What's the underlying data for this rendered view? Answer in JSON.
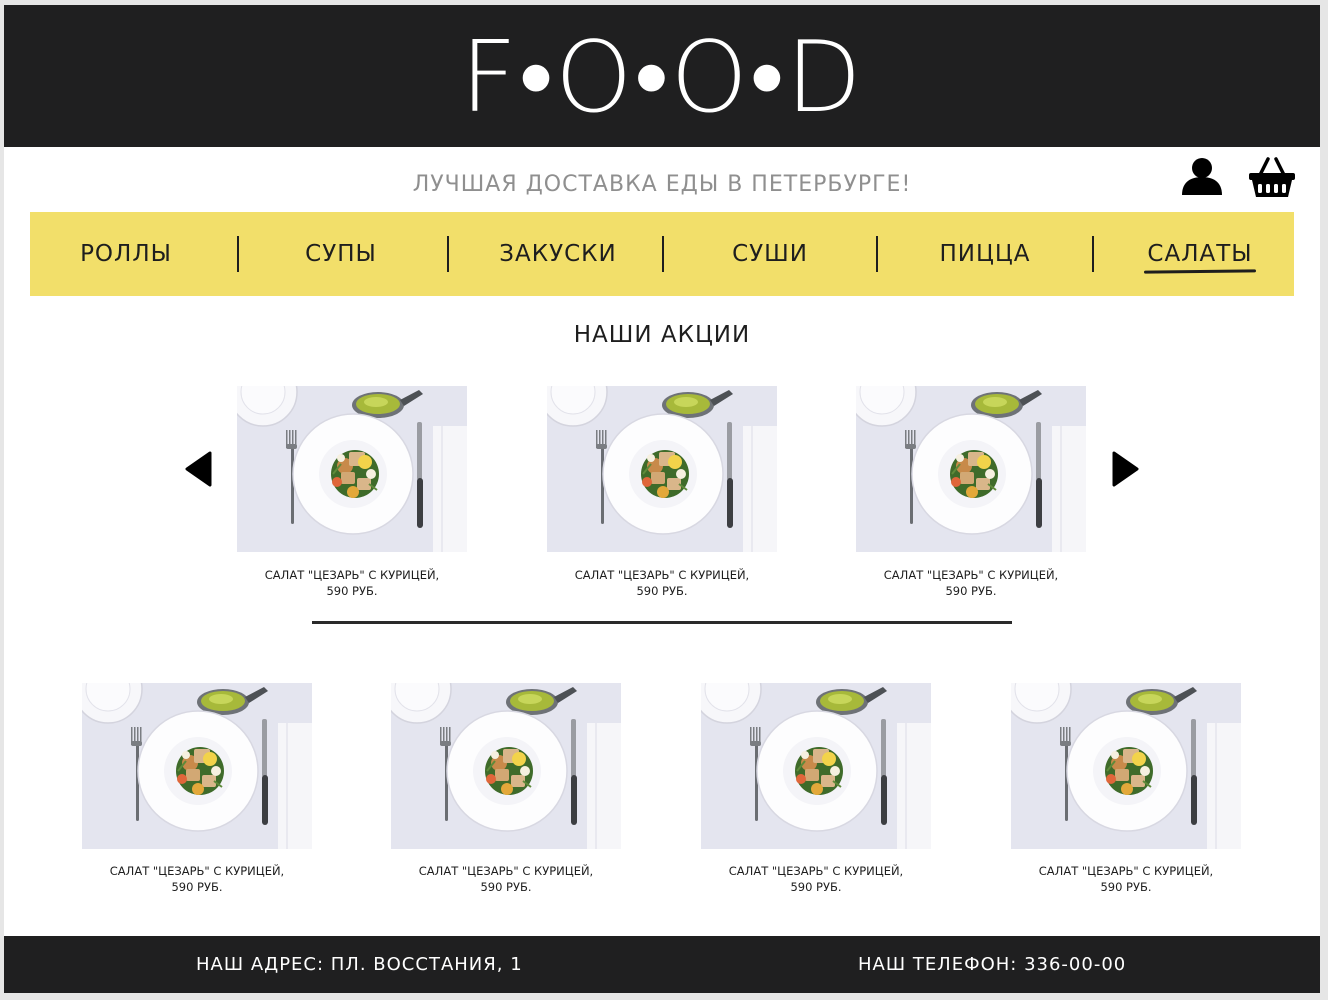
{
  "header": {
    "logo": "F•O•O•D"
  },
  "tagline": "ЛУЧШАЯ ДОСТАВКА ЕДЫ В ПЕТЕРБУРГЕ!",
  "icons": {
    "user": "user-icon",
    "cart": "basket-icon"
  },
  "nav": {
    "items": [
      "РОЛЛЫ",
      "СУПЫ",
      "ЗАКУСКИ",
      "СУШИ",
      "ПИЦЦА",
      "САЛАТЫ"
    ],
    "active": "САЛАТЫ"
  },
  "promo": {
    "title": "НАШИ АКЦИИ",
    "cards": [
      {
        "line1": "САЛАТ \"ЦЕЗАРЬ\" С КУРИЦЕЙ,",
        "line2": "590 РУБ."
      },
      {
        "line1": "САЛАТ \"ЦЕЗАРЬ\" С КУРИЦЕЙ,",
        "line2": "590 РУБ."
      },
      {
        "line1": "САЛАТ \"ЦЕЗАРЬ\" С КУРИЦЕЙ,",
        "line2": "590 РУБ."
      }
    ]
  },
  "products": {
    "cards": [
      {
        "line1": "САЛАТ \"ЦЕЗАРЬ\" С КУРИЦЕЙ,",
        "line2": "590 РУБ."
      },
      {
        "line1": "САЛАТ \"ЦЕЗАРЬ\" С КУРИЦЕЙ,",
        "line2": "590 РУБ."
      },
      {
        "line1": "САЛАТ \"ЦЕЗАРЬ\" С КУРИЦЕЙ,",
        "line2": "590 РУБ."
      },
      {
        "line1": "САЛАТ \"ЦЕЗАРЬ\" С КУРИЦЕЙ,",
        "line2": "590 РУБ."
      }
    ]
  },
  "footer": {
    "address": "НАШ АДРЕС: ПЛ. ВОССТАНИЯ, 1",
    "phone": "НАШ ТЕЛЕФОН: 336-00-00"
  },
  "colors": {
    "dark": "#1f1f20",
    "nav_bg": "#f2df6a",
    "tagline": "#8f8f8f"
  }
}
